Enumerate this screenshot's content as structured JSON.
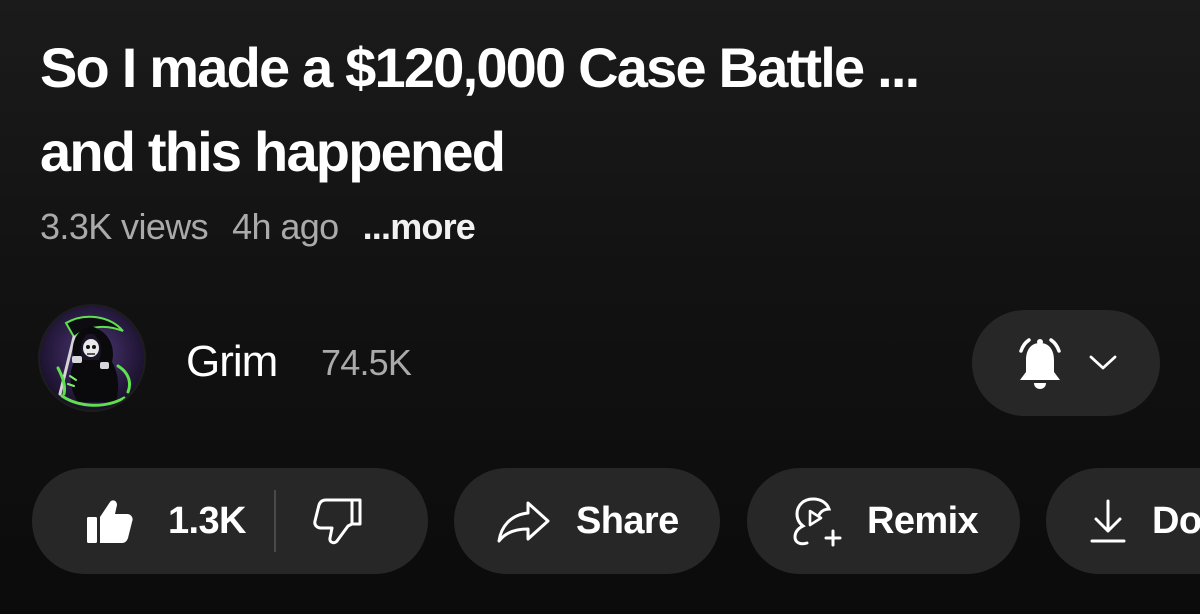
{
  "video": {
    "title": "So I made a  $120,000 Case Battle ...\nand this happened",
    "views": "3.3K views",
    "time_ago": "4h ago",
    "more_label": "...more"
  },
  "channel": {
    "name": "Grim",
    "subscribers": "74.5K",
    "avatar_icon": "grim-reaper-avatar"
  },
  "notification": {
    "icon": "bell-icon",
    "dropdown_icon": "chevron-down-icon"
  },
  "actions": {
    "like_count": "1.3K",
    "like_icon": "thumbs-up-icon",
    "dislike_icon": "thumbs-down-icon",
    "share_label": "Share",
    "share_icon": "share-arrow-icon",
    "remix_label": "Remix",
    "remix_icon": "remix-icon",
    "download_label": "Do",
    "download_icon": "download-icon"
  },
  "colors": {
    "background": "#0f0f0f",
    "pill": "#272727",
    "primary_text": "#ffffff",
    "secondary_text": "#aaaaaa",
    "avatar_accent": "#5fe04d",
    "avatar_bg": "#2b1d45"
  }
}
